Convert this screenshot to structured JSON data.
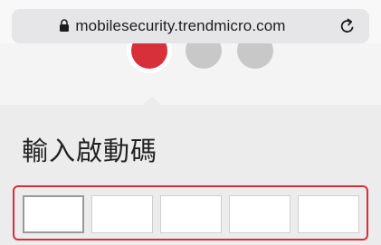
{
  "browser": {
    "url": "mobilesecurity.trendmicro.com",
    "lock_icon": "lock-icon",
    "reload_icon": "reload-icon"
  },
  "steps": {
    "total": 3,
    "current": 1,
    "active_color": "#d8303a",
    "inactive_color": "#c8c8c8"
  },
  "main": {
    "heading": "輸入啟動碼",
    "accent_color": "#d8303a",
    "code_fields": [
      {
        "value": ""
      },
      {
        "value": ""
      },
      {
        "value": ""
      },
      {
        "value": ""
      },
      {
        "value": ""
      }
    ]
  }
}
